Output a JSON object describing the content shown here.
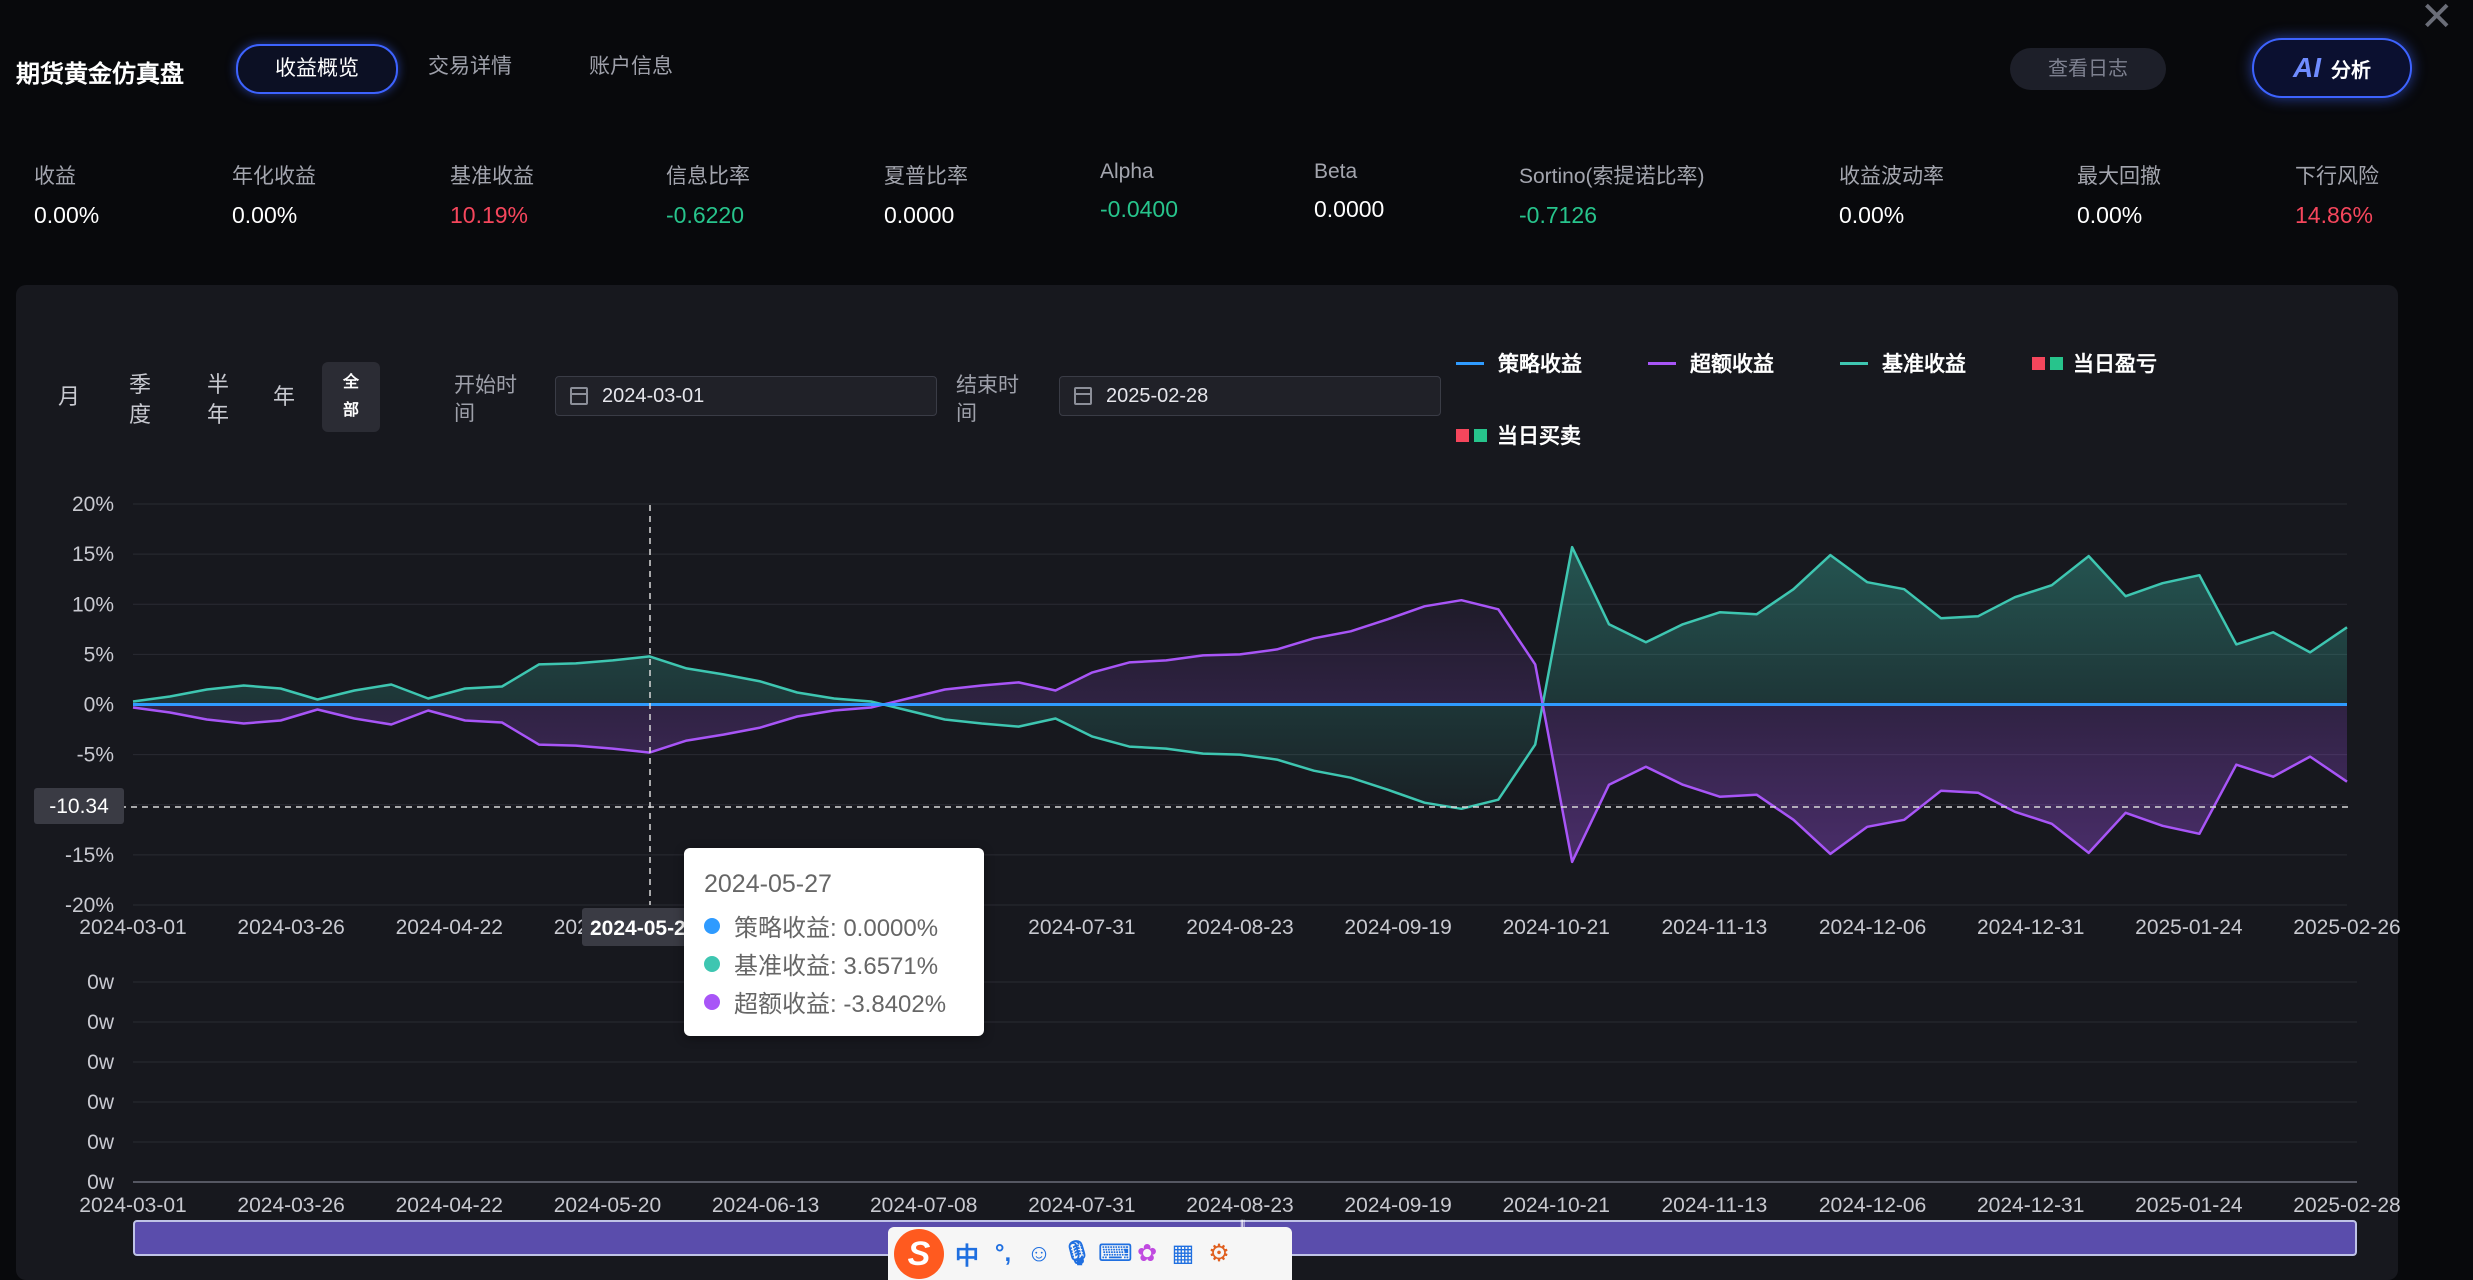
{
  "header": {
    "app_title": "期货黄金仿真盘",
    "tabs": [
      "收益概览",
      "交易详情",
      "账户信息"
    ],
    "log_button": "查看日志",
    "ai_button": {
      "icon_text": "AI",
      "label": "分析"
    }
  },
  "metrics": [
    {
      "label": "收益",
      "value": "0.00%",
      "color": "white"
    },
    {
      "label": "年化收益",
      "value": "0.00%",
      "color": "white"
    },
    {
      "label": "基准收益",
      "value": "10.19%",
      "color": "red"
    },
    {
      "label": "信息比率",
      "value": "-0.6220",
      "color": "green"
    },
    {
      "label": "夏普比率",
      "value": "0.0000",
      "color": "white"
    },
    {
      "label": "Alpha",
      "value": "-0.0400",
      "color": "green"
    },
    {
      "label": "Beta",
      "value": "0.0000",
      "color": "white"
    },
    {
      "label": "Sortino(索提诺比率)",
      "value": "-0.7126",
      "color": "green"
    },
    {
      "label": "收益波动率",
      "value": "0.00%",
      "color": "white"
    },
    {
      "label": "最大回撤",
      "value": "0.00%",
      "color": "white"
    },
    {
      "label": "下行风险",
      "value": "14.86%",
      "color": "red"
    }
  ],
  "filters": {
    "periods": {
      "month": "月",
      "quarter": "季度",
      "half_year": "半年",
      "year": "年",
      "all": "全部"
    },
    "selected_period": "全部",
    "start_label": "开始时间",
    "start_value": "2024-03-01",
    "end_label": "结束时间",
    "end_value": "2025-02-28"
  },
  "legend": {
    "strategy": "策略收益",
    "excess": "超额收益",
    "benchmark": "基准收益",
    "daily_pnl": "当日盈亏",
    "daily_trade": "当日买卖"
  },
  "colors": {
    "strategy": "#2f9bff",
    "excess": "#a855f7",
    "benchmark": "#3ec6b1",
    "red": "#f5465c",
    "green": "#27c48c"
  },
  "crosshair": {
    "y_value": "-10.34",
    "x_value": "2024-05-27"
  },
  "tooltip": {
    "date": "2024-05-27",
    "strategy": "策略收益: 0.0000%",
    "benchmark": "基准收益: 3.6571%",
    "excess": "超额收益: -3.8402%"
  },
  "chart_data": [
    {
      "type": "line",
      "y_ticks": [
        "20%",
        "15%",
        "10%",
        "5%",
        "0%",
        "-5%",
        "-10%",
        "-15%",
        "-20%"
      ],
      "ylim": [
        -20,
        20
      ],
      "x_tick_labels": [
        "2024-03-01",
        "2024-03-26",
        "2024-04-22",
        "2024-05-17",
        "2024-06-13",
        "2024-07-08",
        "2024-07-31",
        "2024-08-23",
        "2024-09-19",
        "2024-10-21",
        "2024-11-13",
        "2024-12-06",
        "2024-12-31",
        "2025-01-24",
        "2025-02-26"
      ],
      "series": [
        {
          "name": "策略收益",
          "values": [
            0,
            0,
            0,
            0,
            0,
            0,
            0,
            0,
            0,
            0,
            0,
            0,
            0,
            0,
            0,
            0,
            0,
            0,
            0,
            0,
            0,
            0,
            0,
            0,
            0,
            0,
            0,
            0,
            0,
            0,
            0,
            0,
            0,
            0,
            0,
            0,
            0,
            0,
            0,
            0,
            0,
            0,
            0,
            0,
            0,
            0,
            0,
            0,
            0,
            0,
            0,
            0,
            0,
            0,
            0,
            0,
            0,
            0,
            0,
            0,
            0
          ]
        },
        {
          "name": "基准收益",
          "values": [
            0.3,
            0.8,
            1.5,
            1.9,
            1.6,
            0.5,
            1.4,
            2.0,
            0.6,
            1.6,
            1.8,
            4.0,
            4.1,
            4.4,
            4.8,
            3.6,
            3.0,
            2.3,
            1.2,
            0.6,
            0.3,
            -0.6,
            -1.5,
            -1.9,
            -2.2,
            -1.4,
            -3.2,
            -4.2,
            -4.4,
            -4.9,
            -5.0,
            -5.5,
            -6.6,
            -7.3,
            -8.5,
            -9.8,
            -10.4,
            -9.5,
            -4.0,
            15.7,
            8.0,
            6.2,
            8.0,
            9.2,
            9.0,
            11.5,
            14.9,
            12.2,
            11.5,
            8.6,
            8.8,
            10.7,
            11.9,
            14.8,
            10.8,
            12.1,
            12.9,
            6.0,
            7.2,
            5.2,
            7.7
          ]
        },
        {
          "name": "超额收益",
          "values": [
            -0.3,
            -0.8,
            -1.5,
            -1.9,
            -1.6,
            -0.5,
            -1.4,
            -2.0,
            -0.6,
            -1.6,
            -1.8,
            -4.0,
            -4.1,
            -4.4,
            -4.8,
            -3.6,
            -3.0,
            -2.3,
            -1.2,
            -0.6,
            -0.3,
            0.6,
            1.5,
            1.9,
            2.2,
            1.4,
            3.2,
            4.2,
            4.4,
            4.9,
            5.0,
            5.5,
            6.6,
            7.3,
            8.5,
            9.8,
            10.4,
            9.5,
            4.0,
            -15.7,
            -8.0,
            -6.2,
            -8.0,
            -9.2,
            -9.0,
            -11.5,
            -14.9,
            -12.2,
            -11.5,
            -8.6,
            -8.8,
            -10.7,
            -11.9,
            -14.8,
            -10.8,
            -12.1,
            -12.9,
            -6.0,
            -7.2,
            -5.2,
            -7.7
          ]
        }
      ]
    },
    {
      "type": "bar",
      "y_ticks": [
        "0w",
        "0w",
        "0w",
        "0w",
        "0w",
        "0w"
      ],
      "x_tick_labels": [
        "2024-03-01",
        "2024-03-26",
        "2024-04-22",
        "2024-05-20",
        "2024-06-13",
        "2024-07-08",
        "2024-07-31",
        "2024-08-23",
        "2024-09-19",
        "2024-10-21",
        "2024-11-13",
        "2024-12-06",
        "2024-12-31",
        "2025-01-24",
        "2025-02-28"
      ],
      "series": [
        {
          "name": "当日盈亏",
          "values": [
            0
          ]
        }
      ]
    }
  ],
  "taskbar": {
    "ime_logo": "S",
    "ime_lang": "中"
  }
}
